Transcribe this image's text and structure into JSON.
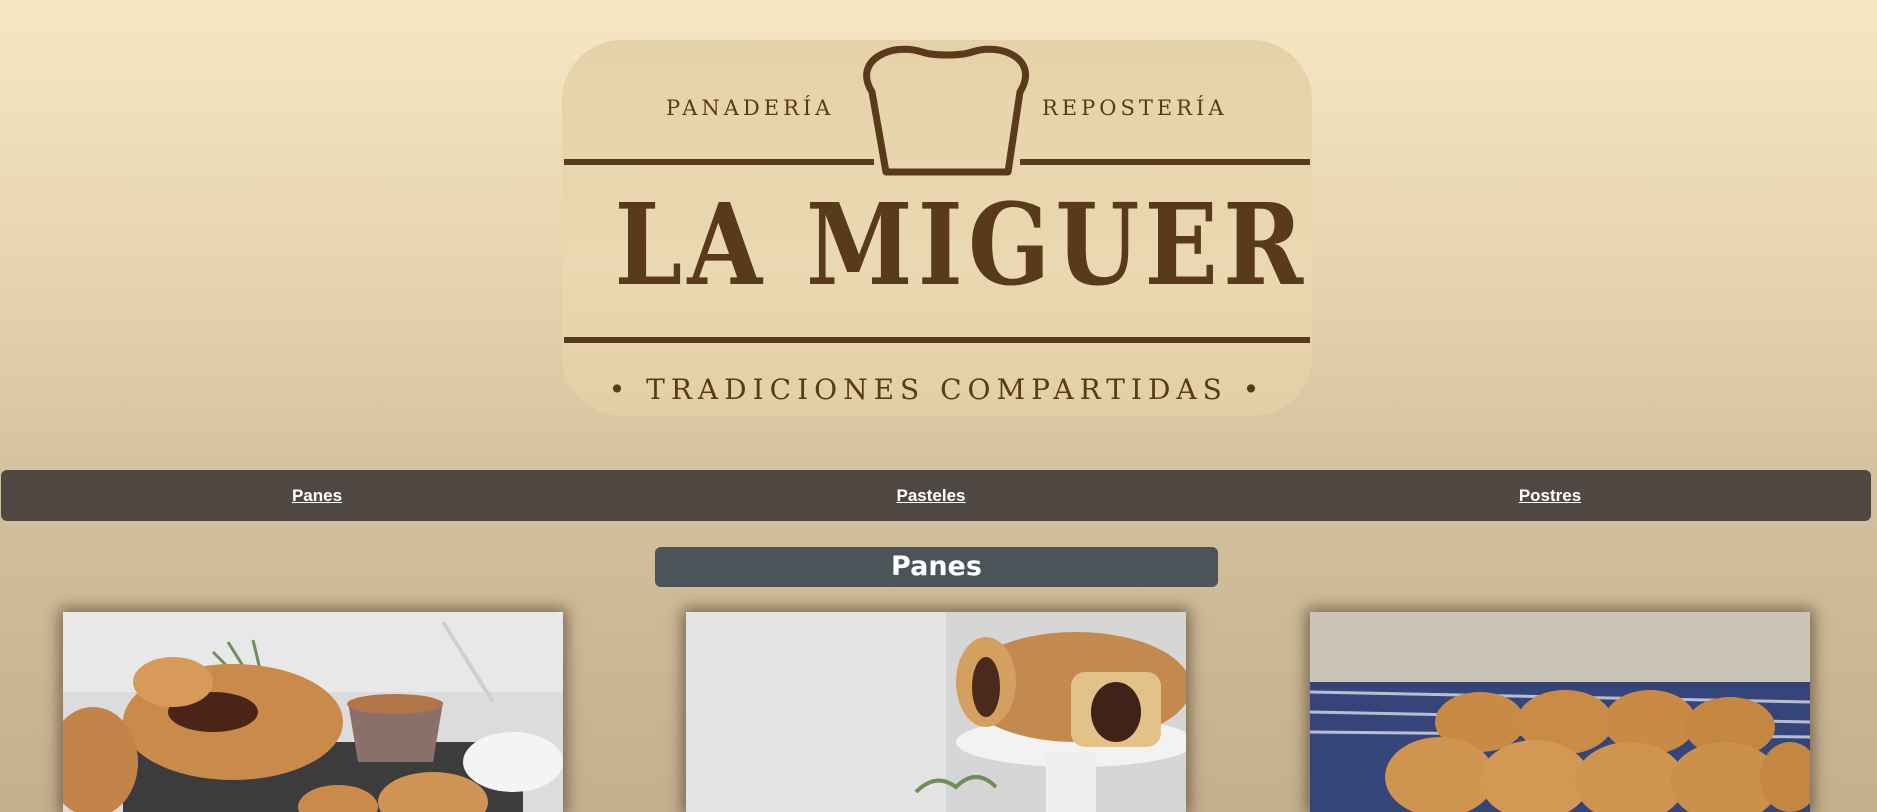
{
  "logo": {
    "top_left": "PANADERÍA",
    "top_right": "REPOSTERÍA",
    "title": "LA MIGUERÍA",
    "tagline": "• TRADICIONES COMPARTIDAS •"
  },
  "nav": {
    "items": [
      {
        "label": "Panes"
      },
      {
        "label": "Pasteles"
      },
      {
        "label": "Postres"
      }
    ]
  },
  "section": {
    "title": "Panes"
  },
  "cards": [
    {
      "image": "bread-with-chocolate-photo"
    },
    {
      "image": "chocolate-bread-ring-on-stand-photo"
    },
    {
      "image": "bread-rolls-on-towel-photo"
    }
  ],
  "colors": {
    "brand_brown": "#5a3a1c",
    "nav_bg": "#504943",
    "section_title_bg": "#4b5458"
  }
}
